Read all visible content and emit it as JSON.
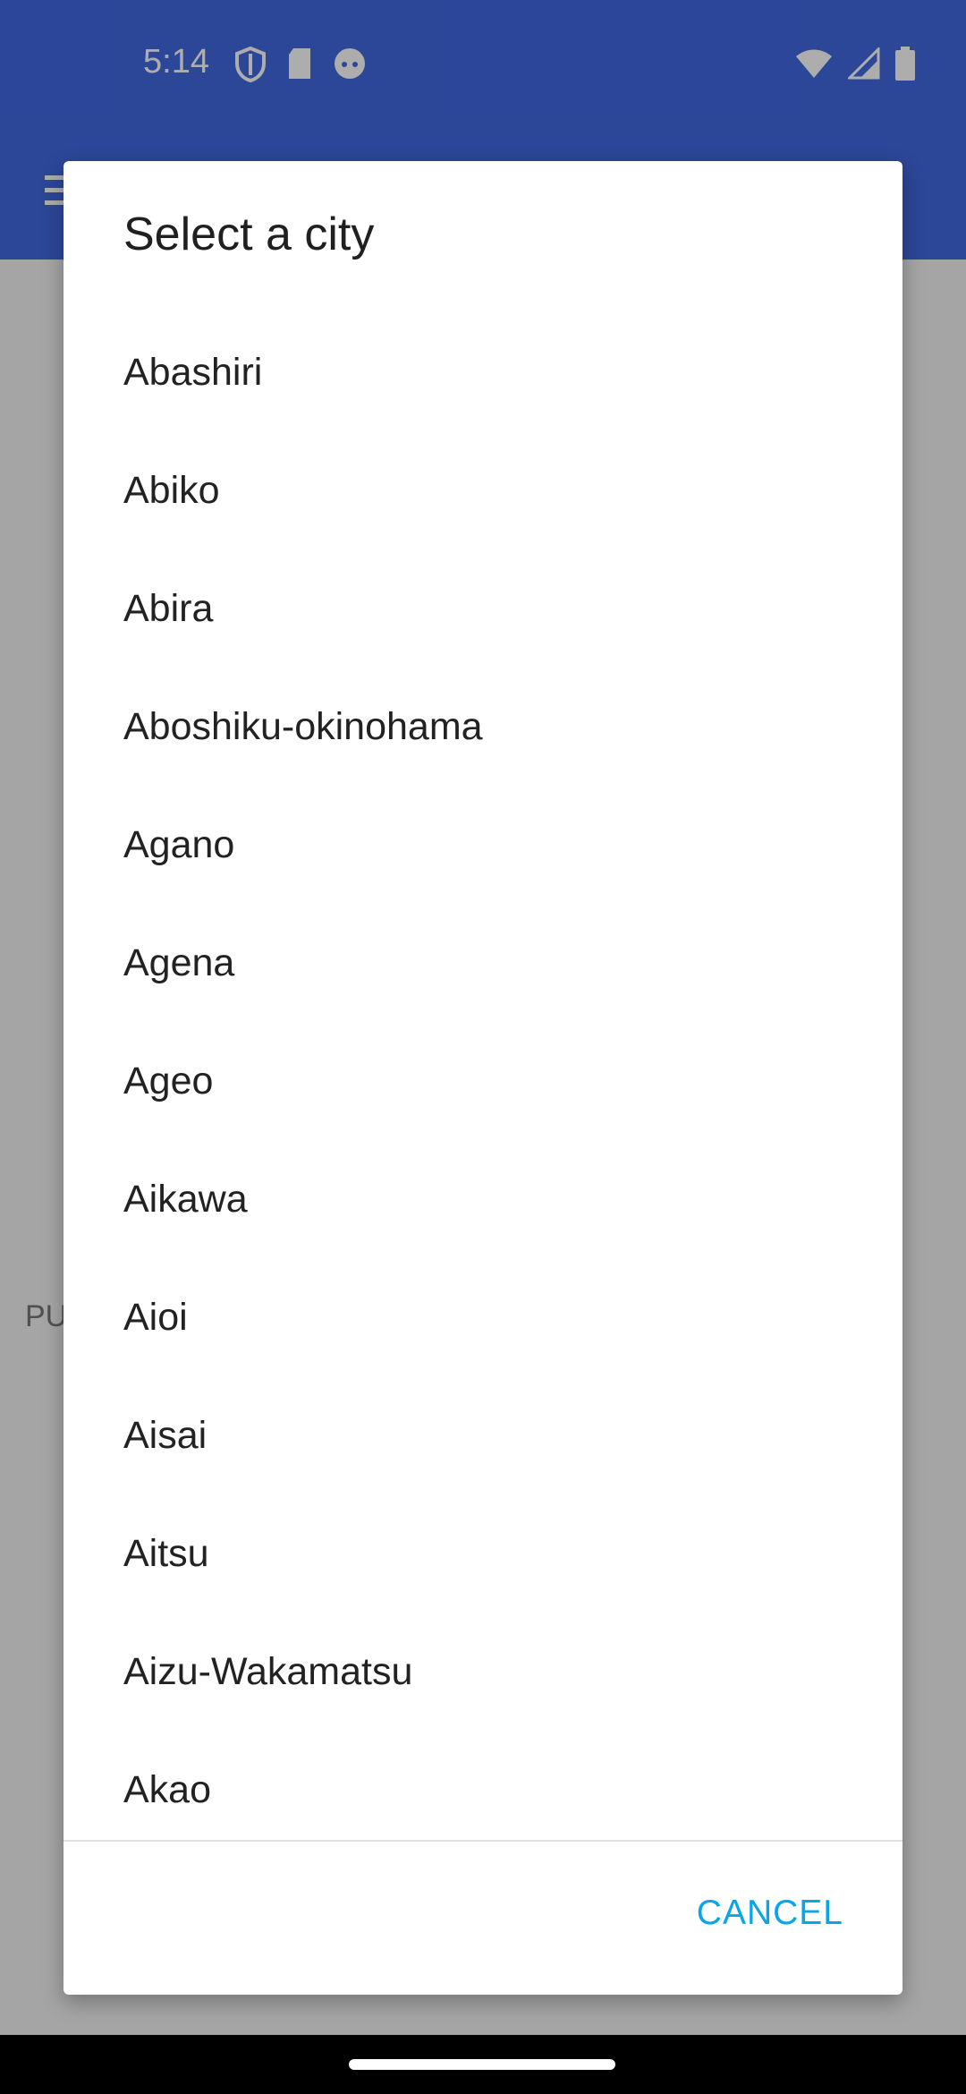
{
  "status_bar": {
    "time": "5:14",
    "left_icons": [
      "shield-icon",
      "sd-card-icon",
      "face-icon"
    ],
    "right_icons": [
      "wifi-icon",
      "signal-icon",
      "battery-icon"
    ]
  },
  "background": {
    "partial_label": "PU"
  },
  "dialog": {
    "title": "Select a city",
    "cities": [
      "Abashiri",
      "Abiko",
      "Abira",
      "Aboshiku-okinohama",
      "Agano",
      "Agena",
      "Ageo",
      "Aikawa",
      "Aioi",
      "Aisai",
      "Aitsu",
      "Aizu-Wakamatsu",
      "Akao"
    ],
    "cancel_label": "CANCEL"
  },
  "colors": {
    "app_bar": "#4169e1",
    "accent": "#0aa5e6"
  }
}
